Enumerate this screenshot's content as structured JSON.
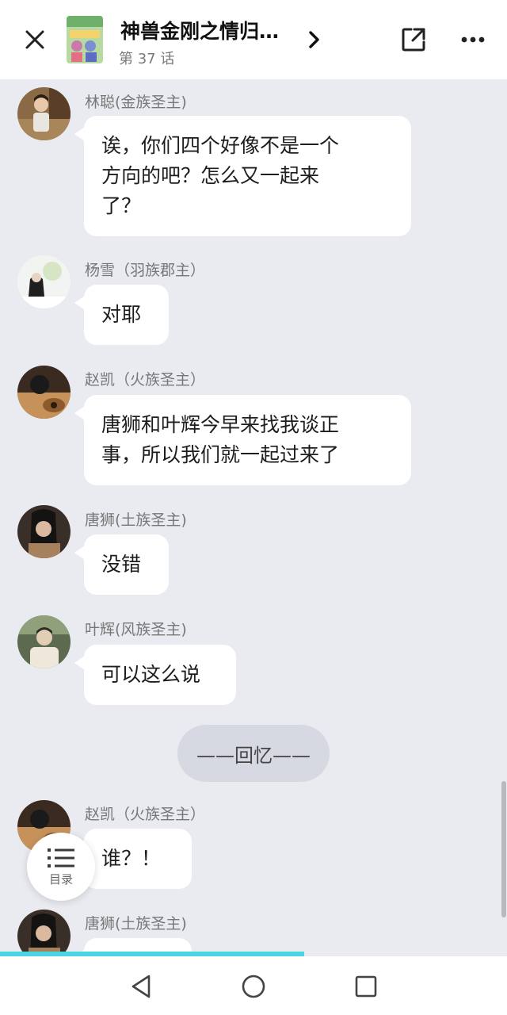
{
  "header": {
    "title": "神兽金刚之情归…",
    "episode": "第 37 话"
  },
  "icons": {
    "close": "close-icon",
    "next": "chevron-right-icon",
    "share": "share-icon",
    "more": "more-icon",
    "toc": "list-icon"
  },
  "messages": [
    {
      "name": "林聪(金族圣主)",
      "lines": [
        "诶，你们四个好像不是一个",
        "方向的吧？怎么又一起来",
        "了？"
      ]
    },
    {
      "name": "杨雪（羽族郡主）",
      "lines": [
        "对耶"
      ]
    },
    {
      "name": "赵凯（火族圣主）",
      "lines": [
        "唐狮和叶辉今早来找我谈正",
        "事，所以我们就一起过来了"
      ]
    },
    {
      "name": "唐狮(土族圣主)",
      "lines": [
        "没错"
      ]
    },
    {
      "name": "叶辉(风族圣主)",
      "lines": [
        "可以这么说"
      ]
    },
    {
      "name": "赵凯（火族圣主）",
      "lines": [
        "谁？！"
      ]
    },
    {
      "name": "唐狮(土族圣主)",
      "lines": [
        ""
      ]
    }
  ],
  "divider": "——回忆——",
  "toc": {
    "label": "目录"
  },
  "progress": {
    "fraction": 0.6
  },
  "colors": {
    "accent": "#4ad6e0",
    "background": "#e9ebf0",
    "bubble": "#ffffff"
  }
}
